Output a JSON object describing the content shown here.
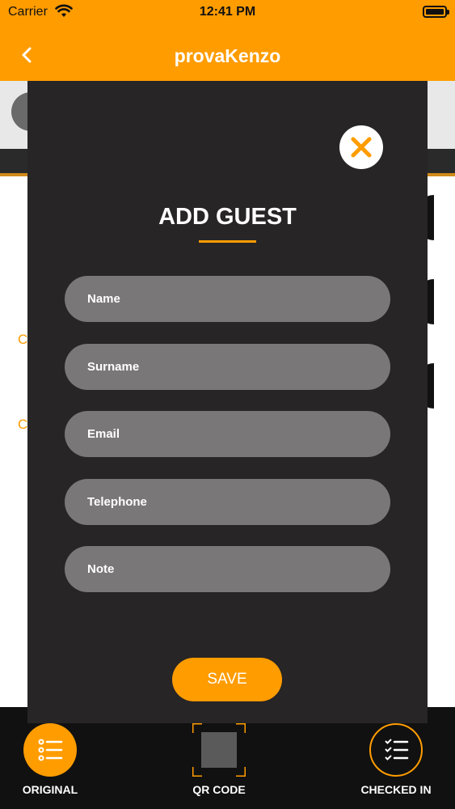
{
  "status_bar": {
    "carrier": "Carrier",
    "time": "12:41 PM"
  },
  "nav": {
    "title": "provaKenzo",
    "back_icon": "chevron-left-icon"
  },
  "background": {
    "letters": [
      "C",
      "C"
    ]
  },
  "modal": {
    "title": "ADD GUEST",
    "close_icon": "close-icon",
    "fields": {
      "name": {
        "placeholder": "Name",
        "value": ""
      },
      "surname": {
        "placeholder": "Surname",
        "value": ""
      },
      "email": {
        "placeholder": "Email",
        "value": ""
      },
      "telephone": {
        "placeholder": "Telephone",
        "value": ""
      },
      "note": {
        "placeholder": "Note",
        "value": ""
      }
    },
    "save_label": "SAVE"
  },
  "tabs": {
    "original": {
      "label": "ORIGINAL",
      "icon": "list-icon"
    },
    "qr_code": {
      "label": "QR CODE",
      "icon": "qr-code-icon"
    },
    "checked_in": {
      "label": "CHECKED IN",
      "icon": "checklist-icon"
    }
  },
  "colors": {
    "accent": "#ff9c00",
    "modal_bg": "#272526",
    "field_bg": "#7a7779",
    "tabbar_bg": "#111111"
  }
}
